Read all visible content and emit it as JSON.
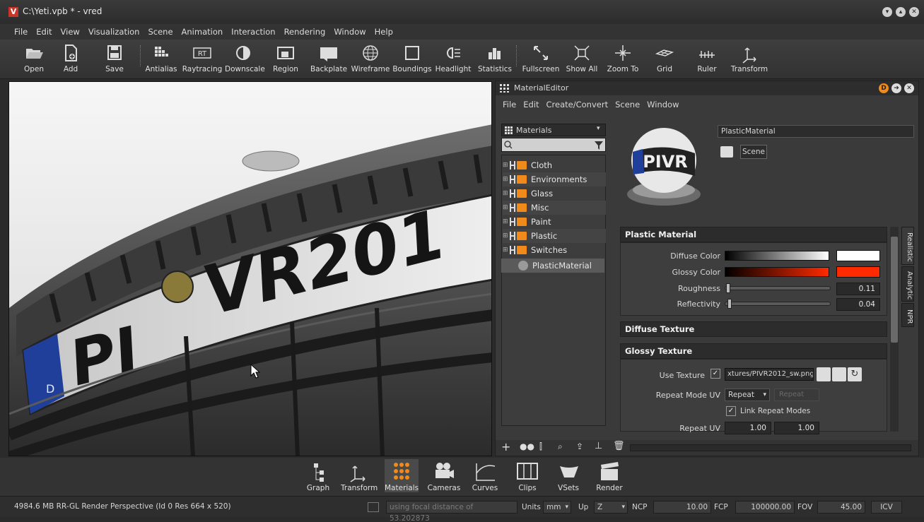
{
  "window": {
    "title": "C:\\Yeti.vpb * - vred",
    "logo_letter": "V"
  },
  "menu": [
    "File",
    "Edit",
    "View",
    "Visualization",
    "Scene",
    "Animation",
    "Interaction",
    "Rendering",
    "Window",
    "Help"
  ],
  "toolbar": {
    "open": "Open",
    "add": "Add",
    "save": "Save",
    "antialias": "Antialias",
    "raytracing": "Raytracing",
    "raytracing_icon_text": "RT",
    "downscale": "Downscale",
    "region": "Region",
    "backplate": "Backplate",
    "wireframe": "Wireframe",
    "boundings": "Boundings",
    "headlight": "Headlight",
    "statistics": "Statistics",
    "fullscreen": "Fullscreen",
    "show_all": "Show All",
    "zoom_to": "Zoom To",
    "grid": "Grid",
    "ruler": "Ruler",
    "transform": "Transform"
  },
  "viewport": {
    "plate_text_1": "PI",
    "plate_text_2": "VR201",
    "plate_country": "D"
  },
  "material_editor": {
    "title": "MaterialEditor",
    "menu": [
      "File",
      "Edit",
      "Create/Convert",
      "Scene",
      "Window"
    ],
    "list_dropdown": "Materials",
    "search_placeholder": "",
    "groups": [
      "Cloth",
      "Environments",
      "Glass",
      "Misc",
      "Paint",
      "Plastic",
      "Switches"
    ],
    "selected_material": "PlasticMaterial",
    "material_name": "PlasticMaterial",
    "scene_button": "Scene",
    "preview_text": "PIVR",
    "plastic_section": "Plastic Material",
    "diffuse_color_label": "Diffuse Color",
    "glossy_color_label": "Glossy Color",
    "roughness_label": "Roughness",
    "roughness_value": "0.11",
    "reflectivity_label": "Reflectivity",
    "reflectivity_value": "0.04",
    "diffuse_texture_section": "Diffuse Texture",
    "glossy_texture_section": "Glossy Texture",
    "use_texture_label": "Use Texture",
    "texture_path": "xtures/PIVR2012_sw.png",
    "repeat_mode_label": "Repeat Mode UV",
    "repeat_mode_value": "Repeat",
    "repeat_mode_value_2": "Repeat",
    "link_repeat_label": "Link Repeat Modes",
    "repeat_uv_label": "Repeat UV",
    "repeat_u": "1.00",
    "repeat_v": "1.00",
    "side_tabs": [
      "Realistic",
      "Analytic",
      "NPR"
    ],
    "colors": {
      "diffuse": "#ffffff",
      "glossy": "#ff2a00"
    }
  },
  "modules": [
    "Graph",
    "Transform",
    "Materials",
    "Cameras",
    "Curves",
    "Clips",
    "VSets",
    "Render"
  ],
  "status": {
    "info": "4984.6 MB  RR-GL  Render Perspective (Id 0 Res 664 x 520)",
    "message": "using focal distance of 53.202873",
    "units_label": "Units",
    "units_value": "mm",
    "up_label": "Up",
    "up_value": "Z",
    "ncp_label": "NCP",
    "ncp_value": "10.00",
    "fcp_label": "FCP",
    "fcp_value": "100000.00",
    "fov_label": "FOV",
    "fov_value": "45.00",
    "icv_button": "ICV"
  }
}
